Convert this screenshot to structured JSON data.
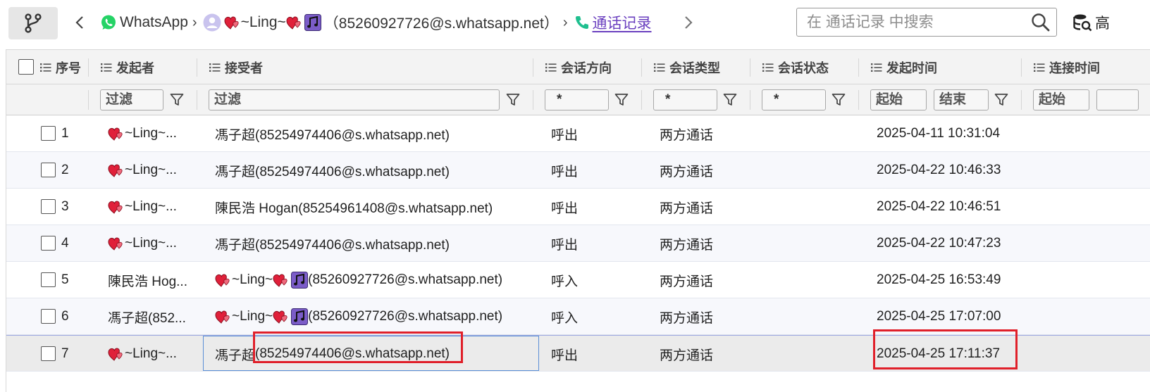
{
  "breadcrumb": {
    "app": "WhatsApp",
    "contact_name": "~Ling~",
    "contact_id": "（85260927726@s.whatsapp.net）",
    "current": "通话记录"
  },
  "search": {
    "placeholder": "在 通话记录 中搜索"
  },
  "toolbar": {
    "advanced_label": "高"
  },
  "columns": {
    "seq": "序号",
    "caller": "发起者",
    "receiver": "接受者",
    "direction": "会话方向",
    "type": "会话类型",
    "status": "会话状态",
    "start_time": "发起时间",
    "connect_time": "连接时间"
  },
  "filters": {
    "caller_placeholder": "过滤",
    "receiver_placeholder": "过滤",
    "direction_value": "*",
    "type_value": "*",
    "status_value": "*",
    "start_from": "起始",
    "start_to": "结束",
    "connect_from": "起始"
  },
  "rows": [
    {
      "seq": "1",
      "caller": "~Ling~...",
      "receiver": "馮子超(85254974406@s.whatsapp.net)",
      "direction": "呼出",
      "type": "两方通话",
      "status": "",
      "start_time": "2025-04-11 10:31:04"
    },
    {
      "seq": "2",
      "caller": "~Ling~...",
      "receiver": "馮子超(85254974406@s.whatsapp.net)",
      "direction": "呼出",
      "type": "两方通话",
      "status": "",
      "start_time": "2025-04-22 10:46:33"
    },
    {
      "seq": "3",
      "caller": "~Ling~...",
      "receiver": "陳民浩 Hogan(85254961408@s.whatsapp.net)",
      "direction": "呼出",
      "type": "两方通话",
      "status": "",
      "start_time": "2025-04-22 10:46:51"
    },
    {
      "seq": "4",
      "caller": "~Ling~...",
      "receiver": "馮子超(85254974406@s.whatsapp.net)",
      "direction": "呼出",
      "type": "两方通话",
      "status": "",
      "start_time": "2025-04-22 10:47:23"
    },
    {
      "seq": "5",
      "caller": "陳民浩 Hog...",
      "receiver_name": "~Ling~",
      "receiver_id": "(85260927726@s.whatsapp.net)",
      "direction": "呼入",
      "type": "两方通话",
      "status": "",
      "start_time": "2025-04-25 16:53:49"
    },
    {
      "seq": "6",
      "caller": "馮子超(852...",
      "receiver_name": "~Ling~",
      "receiver_id": "(85260927726@s.whatsapp.net)",
      "direction": "呼入",
      "type": "两方通话",
      "status": "",
      "start_time": "2025-04-25 17:07:00"
    },
    {
      "seq": "7",
      "caller": "~Ling~...",
      "receiver_name": "馮子超",
      "receiver_id": "(85254974406@s.whatsapp.net)",
      "direction": "呼出",
      "type": "两方通话",
      "status": "",
      "start_time": "2025-04-25 17:11:37"
    }
  ],
  "colors": {
    "accent": "#6a3fbf",
    "whatsapp": "#25d366",
    "highlight": "#e0202a",
    "selection_border": "#5b8fd6"
  },
  "icons": [
    "branch-icon",
    "chevron-left-icon",
    "whatsapp-icon",
    "avatar-icon",
    "heart-emoji-icon",
    "music-note-icon",
    "phone-icon",
    "chevron-right-icon",
    "search-icon",
    "database-search-icon",
    "list-icon",
    "funnel-icon"
  ]
}
